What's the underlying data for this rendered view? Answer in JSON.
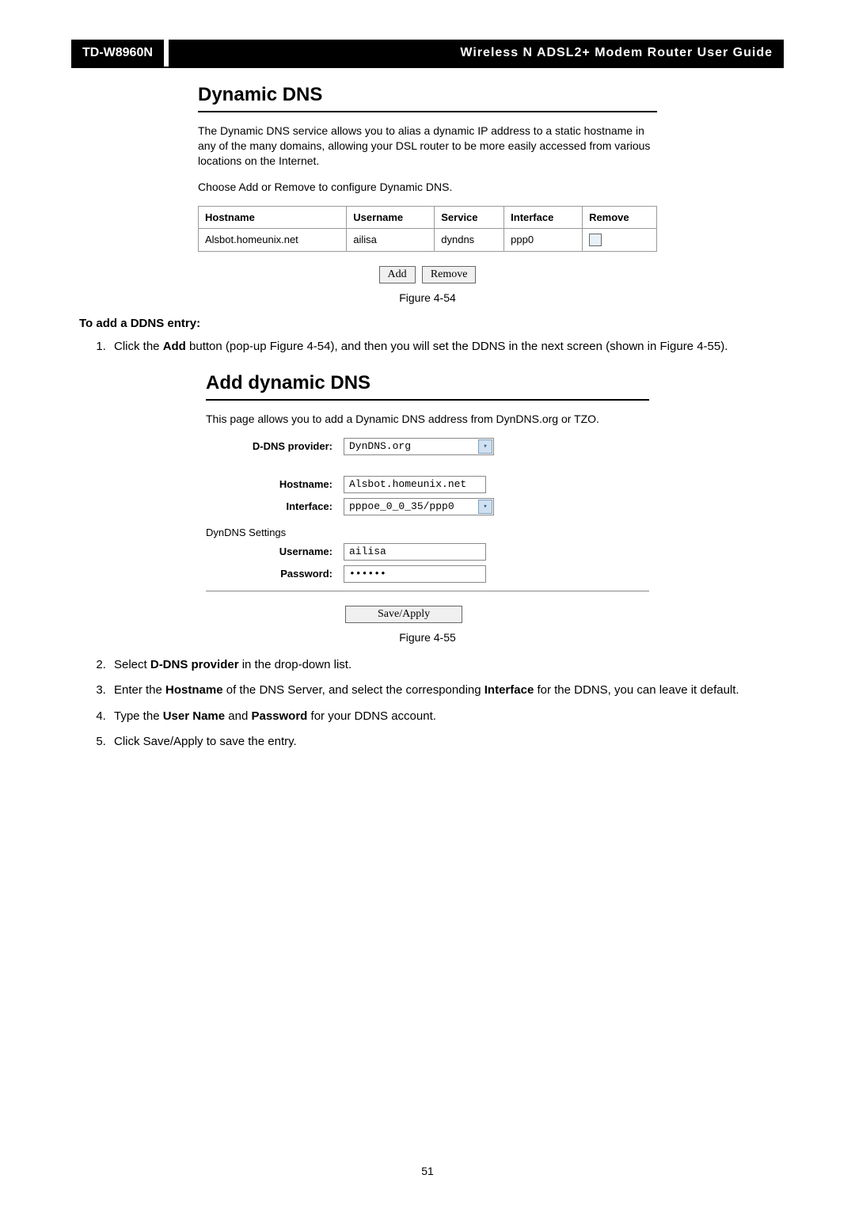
{
  "header": {
    "model": "TD-W8960N",
    "title": "Wireless N ADSL2+ Modem Router User Guide"
  },
  "panel1": {
    "title": "Dynamic DNS",
    "desc": "The Dynamic DNS service allows you to alias a dynamic IP address to a static hostname in any of the many domains, allowing your DSL router to be more easily accessed from various locations on the Internet.",
    "instruction": "Choose Add or Remove to configure Dynamic DNS.",
    "table": {
      "headers": {
        "h1": "Hostname",
        "h2": "Username",
        "h3": "Service",
        "h4": "Interface",
        "h5": "Remove"
      },
      "rows": [
        {
          "hostname": "Alsbot.homeunix.net",
          "username": "ailisa",
          "service": "dyndns",
          "interface": "ppp0"
        }
      ]
    },
    "buttons": {
      "add": "Add",
      "remove": "Remove"
    },
    "caption": "Figure 4-54"
  },
  "section": {
    "label": "To add a DDNS entry:"
  },
  "steps1": {
    "s1_pre": "Click the ",
    "s1_bold": "Add",
    "s1_post": " button (pop-up Figure 4-54), and then you will set the DDNS in the next screen (shown in Figure 4-55)."
  },
  "panel2": {
    "title": "Add dynamic DNS",
    "desc": "This page allows you to add a Dynamic DNS address from DynDNS.org or TZO.",
    "labels": {
      "provider": "D-DNS provider:",
      "hostname": "Hostname:",
      "interface": "Interface:",
      "settings": "DynDNS Settings",
      "username": "Username:",
      "password": "Password:"
    },
    "values": {
      "provider": "DynDNS.org",
      "hostname": "Alsbot.homeunix.net",
      "interface": "pppoe_0_0_35/ppp0",
      "username": "ailisa",
      "password": "••••••"
    },
    "save": "Save/Apply",
    "caption": "Figure 4-55"
  },
  "steps2": {
    "s2_pre": "Select ",
    "s2_bold": "D-DNS provider",
    "s2_post": " in the drop-down list.",
    "s3_pre": "Enter the ",
    "s3_b1": "Hostname",
    "s3_mid": " of the DNS Server, and select the corresponding ",
    "s3_b2": "Interface",
    "s3_post": " for the DDNS, you can leave it default.",
    "s4_pre": "Type the ",
    "s4_b1": "User Name",
    "s4_mid": " and ",
    "s4_b2": "Password",
    "s4_post": " for your DDNS account.",
    "s5": "Click Save/Apply to save the entry."
  },
  "footer": {
    "page": "51"
  }
}
